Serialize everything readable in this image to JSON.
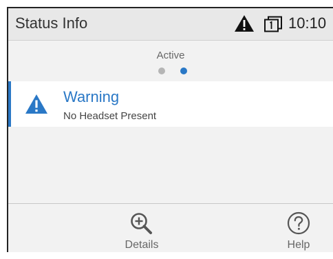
{
  "header": {
    "title": "Status Info",
    "time": "10:10",
    "icons": [
      "warning-icon",
      "screen-icon"
    ]
  },
  "pager": {
    "label": "Active",
    "dots": 2,
    "active_index": 1
  },
  "status": {
    "icon": "warning-icon",
    "title": "Warning",
    "subtitle": "No Headset Present"
  },
  "toolbar": {
    "details_label": "Details",
    "help_label": "Help",
    "details_icon": "zoom-in-icon",
    "help_icon": "help-icon"
  },
  "colors": {
    "accent": "#2a78c6",
    "header_bg": "#e8e8e8",
    "body_bg": "#f2f2f2"
  }
}
